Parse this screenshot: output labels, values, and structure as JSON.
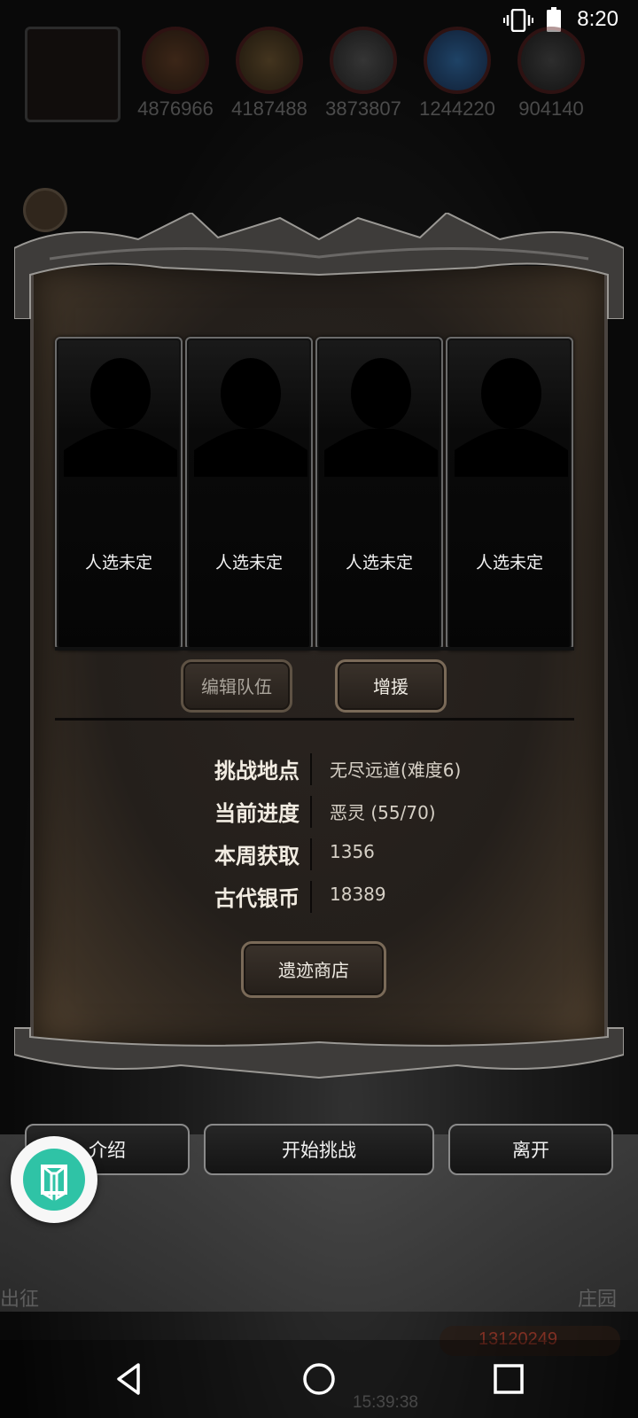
{
  "status": {
    "time": "8:20"
  },
  "resources": [
    {
      "icon": "ore-orb-icon",
      "value": "4876966"
    },
    {
      "icon": "wood-orb-icon",
      "value": "4187488"
    },
    {
      "icon": "iron-orb-icon",
      "value": "3873807"
    },
    {
      "icon": "crystal-orb-icon",
      "value": "1244220"
    },
    {
      "icon": "steel-orb-icon",
      "value": "904140"
    }
  ],
  "team": {
    "slots": [
      {
        "label": "人选未定"
      },
      {
        "label": "人选未定"
      },
      {
        "label": "人选未定"
      },
      {
        "label": "人选未定"
      }
    ],
    "edit_team_label": "编辑队伍",
    "reinforce_label": "增援"
  },
  "info": [
    {
      "label": "挑战地点",
      "value": "无尽远道(难度6)"
    },
    {
      "label": "当前进度",
      "value": "恶灵 (55/70)"
    },
    {
      "label": "本周获取",
      "value": "1356"
    },
    {
      "label": "古代银币",
      "value": "18389"
    }
  ],
  "shop_label": "遗迹商店",
  "actions": {
    "intro_label": "介绍",
    "start_label": "开始挑战",
    "leave_label": "离开"
  },
  "background": {
    "left_label": "出征",
    "right_label": "庄园",
    "gold": "13120249",
    "clock": "15:39:38"
  },
  "colors": {
    "panel": "#241f1b",
    "button_border": "#7a6a58",
    "float_accent": "#2fc3a6"
  }
}
